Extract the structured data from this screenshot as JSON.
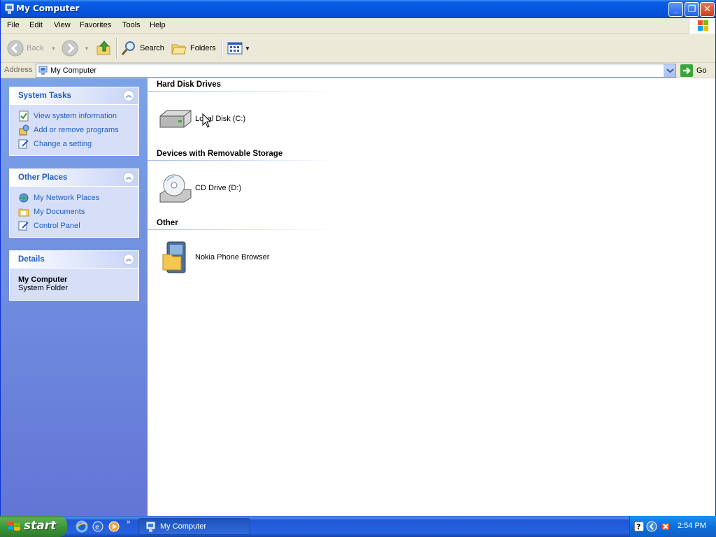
{
  "window": {
    "title": "My Computer"
  },
  "menu": [
    "File",
    "Edit",
    "View",
    "Favorites",
    "Tools",
    "Help"
  ],
  "toolbar": {
    "back": "Back",
    "search": "Search",
    "folders": "Folders"
  },
  "address": {
    "label": "Address",
    "value": "My Computer",
    "go": "Go"
  },
  "left": {
    "system_tasks": {
      "title": "System Tasks",
      "items": [
        "View system information",
        "Add or remove programs",
        "Change a setting"
      ]
    },
    "other_places": {
      "title": "Other Places",
      "items": [
        "My Network Places",
        "My Documents",
        "Control Panel"
      ]
    },
    "details": {
      "title": "Details",
      "name": "My Computer",
      "type": "System Folder"
    }
  },
  "content": {
    "groups": [
      {
        "title": "Hard Disk Drives",
        "items": [
          "Local Disk (C:)"
        ]
      },
      {
        "title": "Devices with Removable Storage",
        "items": [
          "CD Drive (D:)"
        ]
      },
      {
        "title": "Other",
        "items": [
          "Nokia Phone Browser"
        ]
      }
    ]
  },
  "taskbar": {
    "start": "start",
    "task": "My Computer",
    "clock": "2:54 PM"
  },
  "colors": {
    "title_blue": "#0654e0",
    "link_blue": "#215dc6",
    "start_green": "#3f983a"
  }
}
